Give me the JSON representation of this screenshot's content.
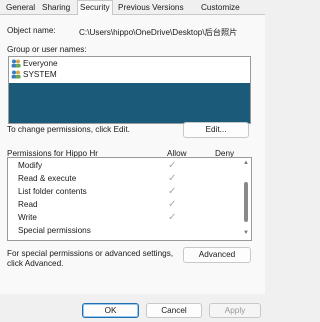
{
  "tabs": [
    "General",
    "Sharing",
    "Security",
    "Previous Versions",
    "Customize"
  ],
  "security": {
    "object_name_label": "Object name:",
    "object_name_value": "C:\\Users\\hippo\\OneDrive\\Desktop\\后台照片",
    "group_label": "Group or user names:",
    "groups": [
      "Everyone",
      "SYSTEM"
    ],
    "change_text": "To change permissions, click Edit.",
    "edit_label": "Edit...",
    "permissions_for": "Permissions for Hippo Hr",
    "allow_header": "Allow",
    "deny_header": "Deny",
    "permissions": [
      {
        "name": "Modify",
        "allow": true
      },
      {
        "name": "Read & execute",
        "allow": true
      },
      {
        "name": "List folder contents",
        "allow": true
      },
      {
        "name": "Read",
        "allow": true
      },
      {
        "name": "Write",
        "allow": true
      },
      {
        "name": "Special permissions",
        "allow": false
      }
    ],
    "special_text_1": "For special permissions or advanced settings,",
    "special_text_2": "click Advanced.",
    "advanced_label": "Advanced"
  },
  "footer": {
    "ok": "OK",
    "cancel": "Cancel",
    "apply": "Apply"
  },
  "icons": {
    "check": "checkmark",
    "user": "users-icon"
  },
  "colors": {
    "selection": "#1c5a79",
    "accent": "#1f6fb5"
  }
}
